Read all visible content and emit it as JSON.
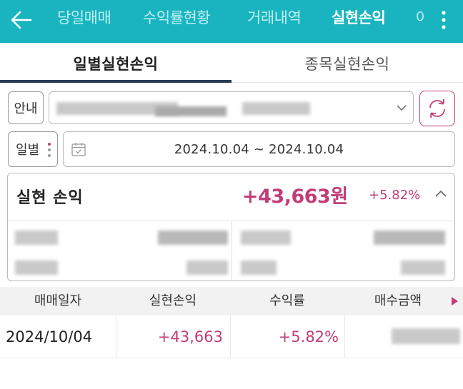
{
  "nav": {
    "tabs": [
      {
        "label": "당일매매"
      },
      {
        "label": "수익률현황"
      },
      {
        "label": "거래내역"
      },
      {
        "label": "실현손익"
      },
      {
        "label": "아"
      }
    ]
  },
  "subtabs": [
    {
      "label": "일별실현손익"
    },
    {
      "label": "종목실현손익"
    }
  ],
  "account": {
    "info_label": "안내"
  },
  "date": {
    "label": "일별",
    "range": "2024.10.04 ~ 2024.10.04"
  },
  "summary": {
    "title": "실현 손익",
    "amount": "+43,663원",
    "rate": "+5.82%"
  },
  "table": {
    "headers": [
      "매매일자",
      "실현손익",
      "수익률",
      "매수금액"
    ],
    "rows": [
      {
        "date": "2024/10/04",
        "profit": "+43,663",
        "rate": "+5.82%"
      }
    ]
  },
  "colors": {
    "brand": "#19b4bf",
    "accent": "#c23d78",
    "tab_underline": "#2a3a55"
  }
}
